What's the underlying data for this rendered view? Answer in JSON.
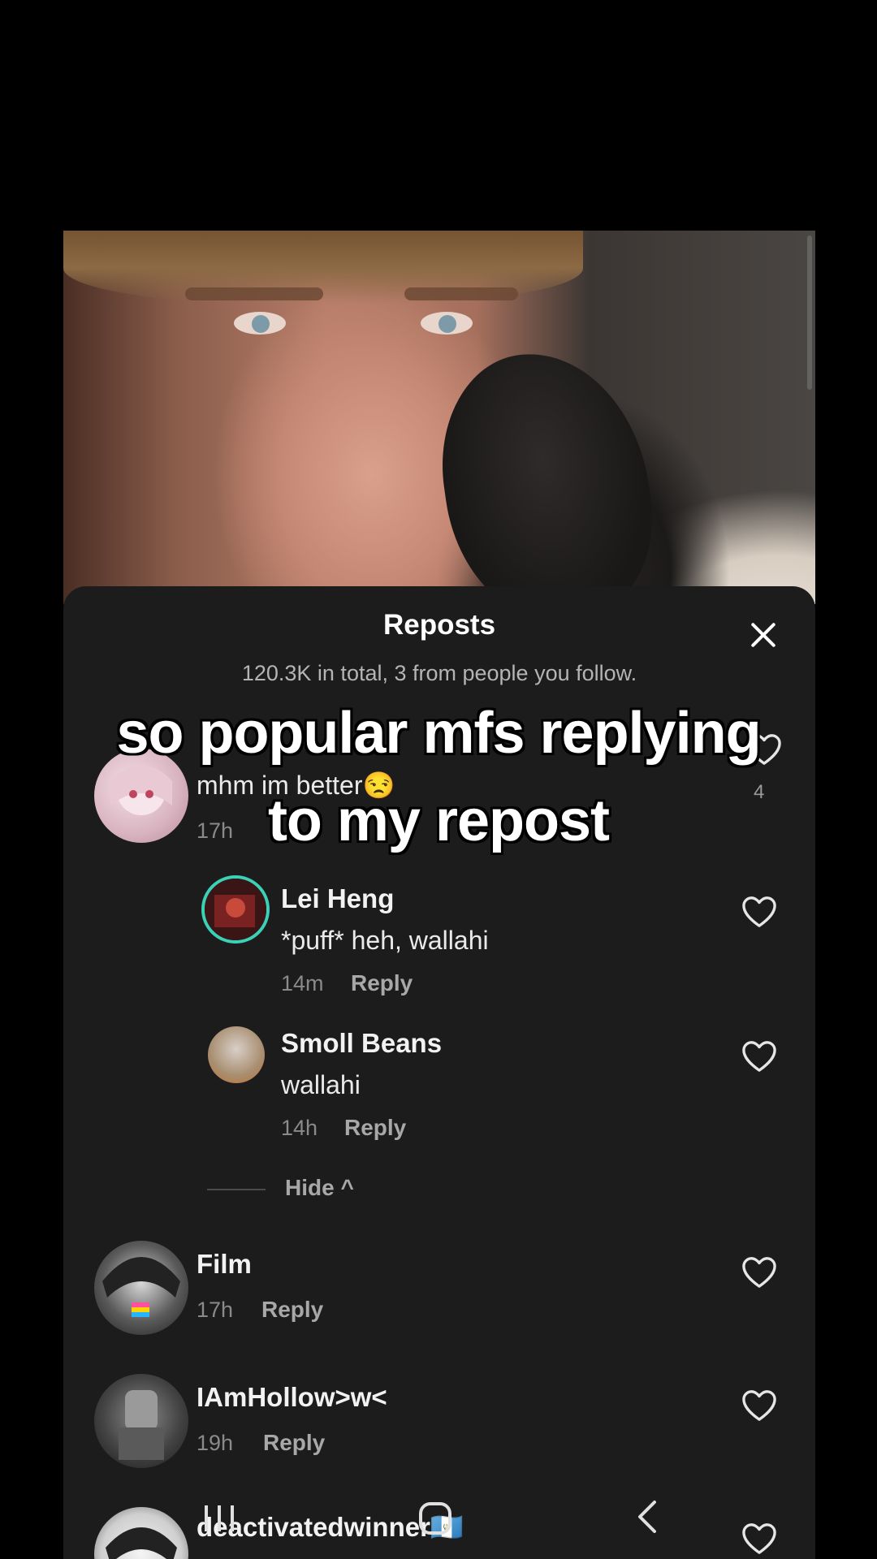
{
  "sheet": {
    "title": "Reposts",
    "subtitle": "120.3K in total, 3 from people you follow."
  },
  "caption": {
    "line1": "so popular mfs replying",
    "line2": "to my repost"
  },
  "comments": {
    "top": {
      "text": "mhm im better😒",
      "time": "17h",
      "like_count": "4"
    },
    "lei": {
      "name": "Lei Heng",
      "text": "*puff* heh, wallahi",
      "time": "14m",
      "reply": "Reply"
    },
    "smoll": {
      "name": "Smoll Beans",
      "text": "wallahi",
      "time": "14h",
      "reply": "Reply"
    },
    "hide": "Hide ^",
    "film": {
      "name": "Film",
      "time": "17h",
      "reply": "Reply"
    },
    "hollow": {
      "name": "IAmHollow>w<",
      "time": "19h",
      "reply": "Reply"
    },
    "deact": {
      "name": "deactivatedwinner🇬🇹"
    }
  },
  "icons": {
    "close": "close-icon",
    "heart": "heart-outline-icon",
    "nav_recent": "recent-apps-icon",
    "nav_home": "home-icon",
    "nav_back": "back-icon"
  },
  "colors": {
    "sheet_bg": "#1c1c1c",
    "accent_ring": "#3ad1b7"
  }
}
